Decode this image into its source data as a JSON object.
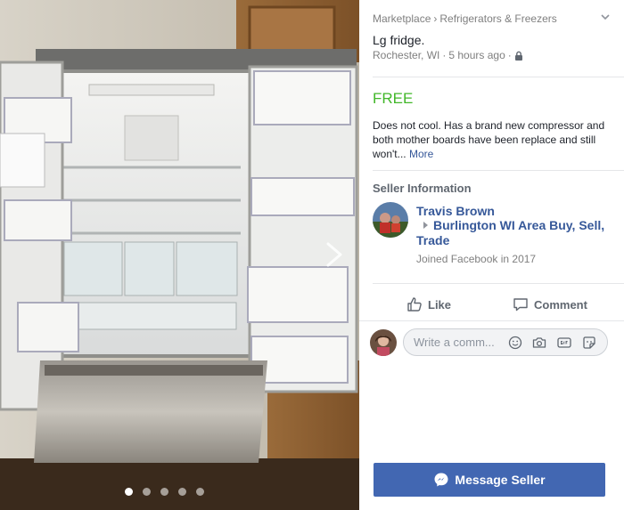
{
  "breadcrumb": {
    "root": "Marketplace",
    "separator": "›",
    "category": "Refrigerators & Freezers"
  },
  "listing": {
    "title": "Lg fridge.",
    "location": "Rochester, WI",
    "dot": "·",
    "time": "5 hours ago",
    "price": "FREE",
    "description": "Does not cool. Has a brand new compressor and both mother boards have been replace and still won't...",
    "more_label": "More"
  },
  "seller": {
    "section_title": "Seller Information",
    "name": "Travis Brown",
    "group": "Burlington WI Area Buy, Sell, Trade",
    "joined": "Joined Facebook in 2017"
  },
  "actions": {
    "like": "Like",
    "comment": "Comment"
  },
  "comment_box": {
    "placeholder": "Write a comm..."
  },
  "message_button": "Message Seller",
  "gallery": {
    "total_dots": 5,
    "active_index": 0
  },
  "colors": {
    "price": "#42b72a",
    "link": "#365899",
    "button": "#4267b2"
  },
  "icons": [
    "chevron-down-icon",
    "lock-icon",
    "like-icon",
    "comment-icon",
    "emoji-icon",
    "camera-icon",
    "gif-icon",
    "sticker-icon",
    "messenger-icon",
    "next-arrow-icon"
  ]
}
